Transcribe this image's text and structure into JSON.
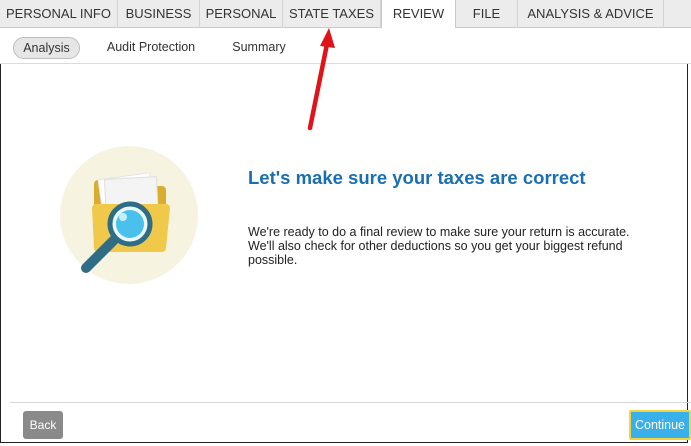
{
  "top_nav": {
    "tabs": [
      {
        "label": "PERSONAL INFO"
      },
      {
        "label": "BUSINESS"
      },
      {
        "label": "PERSONAL"
      },
      {
        "label": "STATE TAXES"
      },
      {
        "label": "REVIEW"
      },
      {
        "label": "FILE"
      },
      {
        "label": "ANALYSIS & ADVICE"
      }
    ],
    "active_tab": "REVIEW"
  },
  "sub_nav": {
    "items": [
      {
        "label": "Analysis"
      },
      {
        "label": "Audit Protection"
      },
      {
        "label": "Summary"
      }
    ],
    "active_item": "Analysis"
  },
  "main": {
    "heading": "Let's make sure your taxes are correct",
    "body": "We're ready to do a final review to make sure your return is accurate. We'll also check for other deductions so you get your biggest refund possible.",
    "illustration_icon": "folder-magnifier-icon"
  },
  "footer": {
    "back_label": "Back",
    "continue_label": "Continue"
  },
  "annotation": {
    "arrow_color": "#e0131b",
    "points_to": "STATE TAXES"
  },
  "colors": {
    "heading": "#1a6fb3",
    "continue_button": "#39b0ea",
    "continue_border": "#f3d33a",
    "back_button": "#8a8a8a",
    "folder": "#f0c94b",
    "magnifier_handle": "#2f6c86",
    "magnifier_lens": "#4ac0ec"
  }
}
